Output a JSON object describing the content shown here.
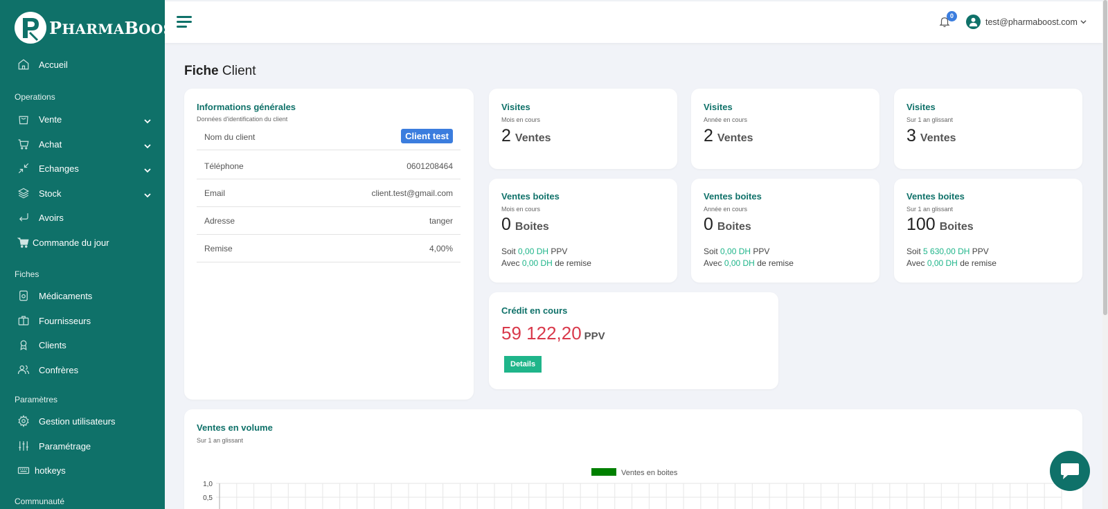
{
  "brand": {
    "logo_letter": "P",
    "name_prefix": "P",
    "name_rest": "HARMA",
    "name2_prefix": "B",
    "name2_rest": "OOST"
  },
  "sidebar": {
    "home": {
      "label": "Accueil",
      "icon": "home-icon"
    },
    "sections": [
      {
        "title": "Operations",
        "items": [
          {
            "label": "Vente",
            "icon": "bag-icon",
            "expandable": true
          },
          {
            "label": "Achat",
            "icon": "cart-icon",
            "expandable": true
          },
          {
            "label": "Echanges",
            "icon": "exchange-icon",
            "expandable": true
          },
          {
            "label": "Stock",
            "icon": "layers-icon",
            "expandable": true
          },
          {
            "label": "Avoirs",
            "icon": "return-icon",
            "expandable": false
          },
          {
            "label": "Commande du jour",
            "icon": "cart-filled-icon",
            "expandable": false
          }
        ]
      },
      {
        "title": "Fiches",
        "items": [
          {
            "label": "Médicaments",
            "icon": "medicine-icon"
          },
          {
            "label": "Fournisseurs",
            "icon": "briefcase-icon"
          },
          {
            "label": "Clients",
            "icon": "award-icon"
          },
          {
            "label": "Confrères",
            "icon": "users-icon"
          }
        ]
      },
      {
        "title": "Paramètres",
        "items": [
          {
            "label": "Gestion utilisateurs",
            "icon": "gear-icon"
          },
          {
            "label": "Paramétrage",
            "icon": "sliders-icon"
          },
          {
            "label": "hotkeys",
            "icon": "keyboard-icon"
          }
        ]
      },
      {
        "title": "Communauté",
        "items": []
      }
    ]
  },
  "topbar": {
    "notif_count": "0",
    "user_email": "test@pharmaboost.com"
  },
  "page": {
    "title_bold": "Fiche",
    "title_rest": "Client"
  },
  "info": {
    "title": "Informations générales",
    "subtitle": "Données d'identification du client",
    "rows": [
      {
        "key": "Nom du client",
        "value": "Client test"
      },
      {
        "key": "Téléphone",
        "value": "0601208464"
      },
      {
        "key": "Email",
        "value": "client.test@gmail.com"
      },
      {
        "key": "Adresse",
        "value": "tanger"
      },
      {
        "key": "Remise",
        "value": "4,00%"
      }
    ]
  },
  "visites": [
    {
      "title": "Visites",
      "period": "Mois en cours",
      "value": "2",
      "unit": "Ventes"
    },
    {
      "title": "Visites",
      "period": "Année en cours",
      "value": "2",
      "unit": "Ventes"
    },
    {
      "title": "Visites",
      "period": "Sur 1 an glissant",
      "value": "3",
      "unit": "Ventes"
    }
  ],
  "ventes_boites": [
    {
      "title": "Ventes boites",
      "period": "Mois en cours",
      "value": "0",
      "unit": "Boites",
      "soit_label": "Soit",
      "ppv_amount": "0,00 DH",
      "ppv_label": "PPV",
      "avec_label": "Avec",
      "remise_amount": "0,00 DH",
      "remise_label": "de remise"
    },
    {
      "title": "Ventes boites",
      "period": "Année en cours",
      "value": "0",
      "unit": "Boites",
      "soit_label": "Soit",
      "ppv_amount": "0,00 DH",
      "ppv_label": "PPV",
      "avec_label": "Avec",
      "remise_amount": "0,00 DH",
      "remise_label": "de remise"
    },
    {
      "title": "Ventes boites",
      "period": "Sur 1 an glissant",
      "value": "100",
      "unit": "Boites",
      "soit_label": "Soit",
      "ppv_amount": "5 630,00 DH",
      "ppv_label": "PPV",
      "avec_label": "Avec",
      "remise_amount": "0,00 DH",
      "remise_label": "de remise"
    }
  ],
  "credit": {
    "title": "Crédit en cours",
    "value": "59 122,20",
    "unit": "PPV",
    "button": "Details"
  },
  "volume": {
    "title": "Ventes en volume",
    "subtitle": "Sur 1 an glissant"
  },
  "colors": {
    "sidebar": "#0f7169",
    "accent_blue": "#3b7dde",
    "green": "#1fb58a",
    "red": "#d9394b",
    "legend_green": "#008000"
  },
  "chart_data": {
    "type": "bar",
    "series": [
      {
        "name": "Ventes en boites",
        "values": []
      }
    ],
    "yticks": [
      "1,0",
      "0,5"
    ],
    "legend": "top-center",
    "grid": true
  }
}
